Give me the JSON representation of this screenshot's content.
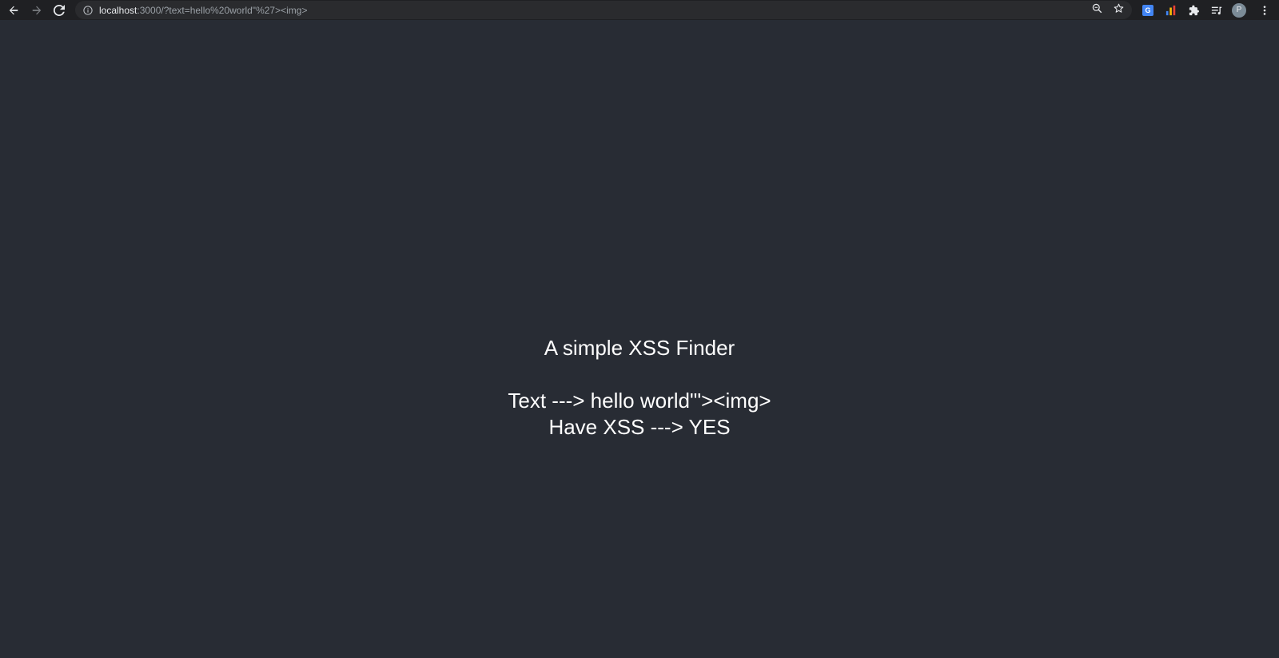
{
  "browser": {
    "url_host": "localhost",
    "url_rest": ":3000/?text=hello%20world\"%27><img>",
    "icons": {
      "back": "arrow-left-icon",
      "forward": "arrow-right-icon",
      "reload": "reload-icon",
      "info": "info-icon",
      "zoom": "zoom-icon",
      "bookmark": "star-icon",
      "translate": "google-translate-icon",
      "analytics": "analytics-icon",
      "extensions": "puzzle-icon",
      "media": "media-control-icon",
      "menu": "kebab-menu-icon"
    },
    "avatar_letter": "P",
    "translate_glyph": "G"
  },
  "page": {
    "title": "A simple XSS Finder",
    "text_line": "Text ---> hello world\"'><img>",
    "xss_line": "Have XSS ---> YES"
  },
  "colors": {
    "page_background": "#282c34",
    "toolbar_background": "#1f2023",
    "text": "#ffffff"
  }
}
